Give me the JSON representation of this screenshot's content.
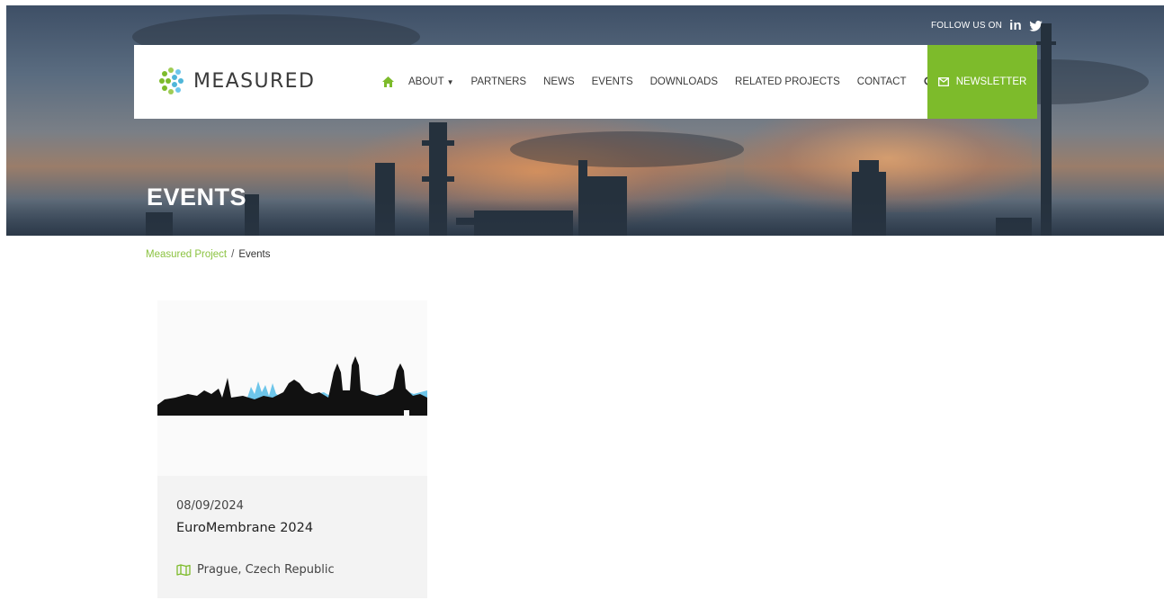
{
  "header": {
    "follow_label": "FOLLOW US ON",
    "social": [
      "linkedin-icon",
      "twitter-icon"
    ]
  },
  "nav": {
    "logo_text": "MEASURED",
    "items": [
      {
        "label": "ABOUT",
        "has_dropdown": true
      },
      {
        "label": "PARTNERS"
      },
      {
        "label": "NEWS"
      },
      {
        "label": "EVENTS"
      },
      {
        "label": "DOWNLOADS"
      },
      {
        "label": "RELATED PROJECTS"
      },
      {
        "label": "CONTACT"
      }
    ],
    "newsletter_label": "NEWSLETTER"
  },
  "hero": {
    "title": "EVENTS"
  },
  "breadcrumb": {
    "root": "Measured Project",
    "separator": "/",
    "current": "Events"
  },
  "events": [
    {
      "date": "08/09/2024",
      "title": "EuroMembrane 2024",
      "location": "Prague, Czech Republic"
    }
  ],
  "colors": {
    "accent": "#7dbb2b",
    "breadcrumb_link": "#8cc342",
    "card_bg": "#f3f3f3",
    "skyline_blue": "#6ec6ea"
  }
}
